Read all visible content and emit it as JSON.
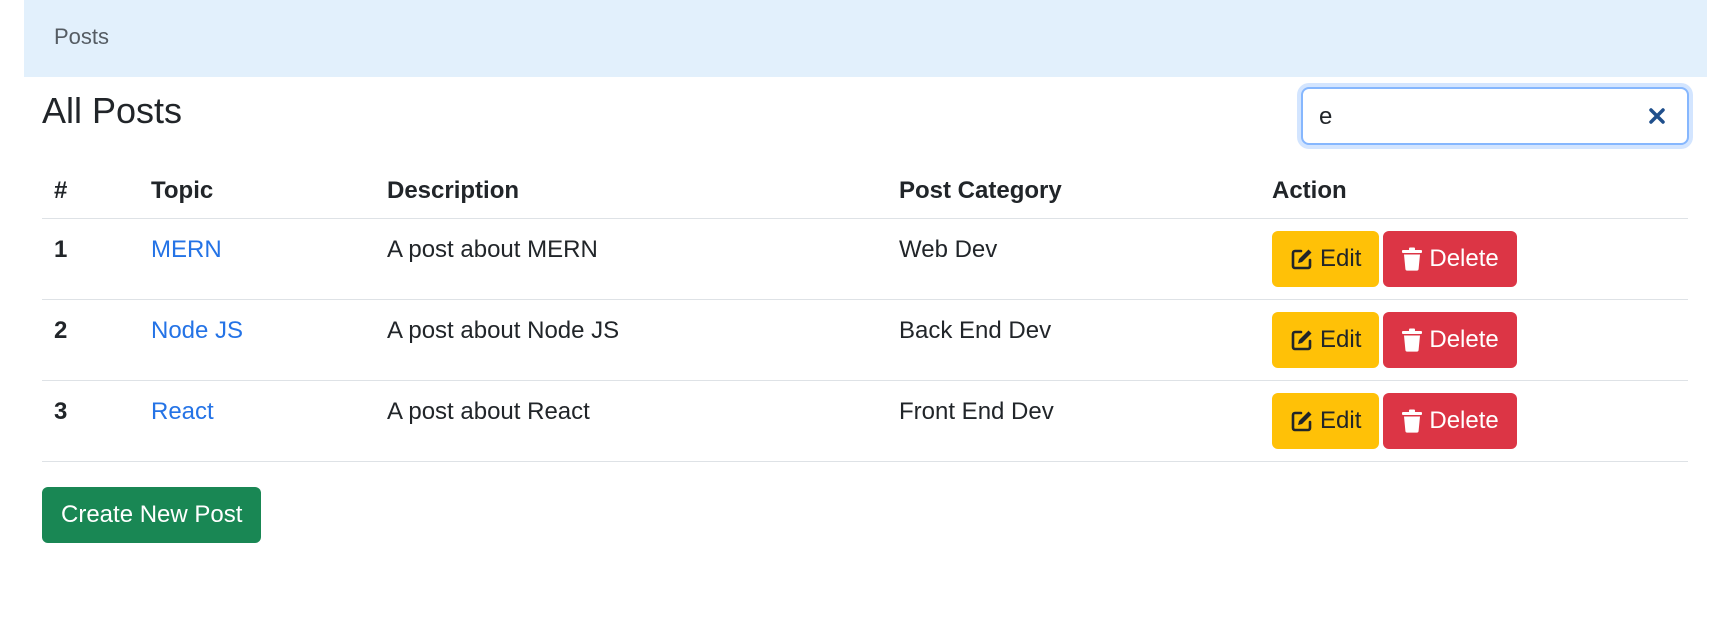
{
  "navbar": {
    "brand": "Posts"
  },
  "page": {
    "title": "All Posts"
  },
  "search": {
    "value": "e",
    "placeholder": ""
  },
  "table": {
    "headers": {
      "num": "#",
      "topic": "Topic",
      "description": "Description",
      "category": "Post Category",
      "action": "Action"
    },
    "rows": [
      {
        "num": "1",
        "topic": "MERN",
        "description": "A post about MERN",
        "category": "Web Dev"
      },
      {
        "num": "2",
        "topic": "Node JS",
        "description": "A post about Node JS",
        "category": "Back End Dev"
      },
      {
        "num": "3",
        "topic": "React",
        "description": "A post about React",
        "category": "Front End Dev"
      }
    ],
    "edit_label": "Edit",
    "delete_label": "Delete"
  },
  "create_button": "Create New Post",
  "colors": {
    "navbar_bg": "#e2f0fc",
    "link": "#2473e6",
    "edit": "#ffc107",
    "delete": "#dc3545",
    "create": "#198754",
    "clear_icon": "#1f4f8c"
  },
  "icons": {
    "clear": "close-icon",
    "edit": "pencil-square-icon",
    "delete": "trash-icon"
  }
}
